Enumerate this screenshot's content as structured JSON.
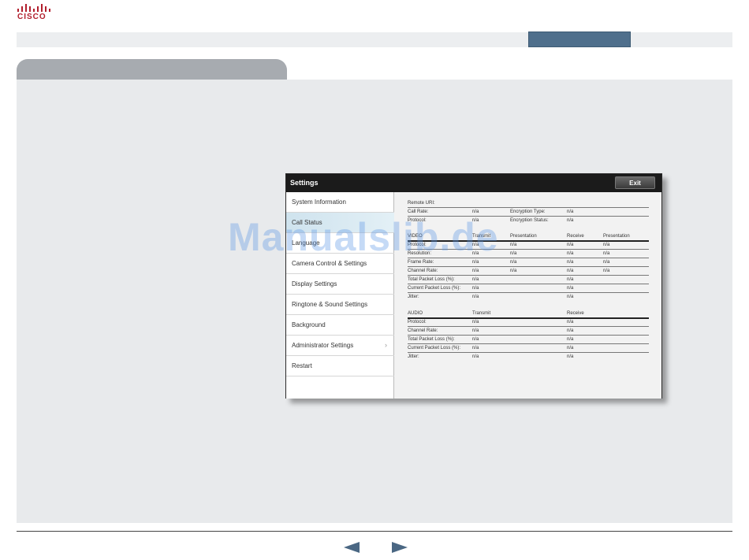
{
  "brand": {
    "logo_text": "CISCO",
    "color": "#b21f2d"
  },
  "nav": {
    "active_color": "#4f6f8c"
  },
  "window": {
    "title": "Settings",
    "exit_label": "Exit",
    "menu": [
      {
        "label": "System Information"
      },
      {
        "label": "Call Status"
      },
      {
        "label": "Language"
      },
      {
        "label": "Camera Control & Settings"
      },
      {
        "label": "Display Settings"
      },
      {
        "label": "Ringtone & Sound Settings"
      },
      {
        "label": "Background"
      },
      {
        "label": "Administrator Settings",
        "chevron": "chevron-right-icon"
      },
      {
        "label": "Restart"
      }
    ],
    "detail": {
      "remote_uri_label": "Remote URI:",
      "call_rate_label": "Call Rate:",
      "call_rate_value": "n/a",
      "encryption_type_label": "Encryption Type:",
      "encryption_type_value": "n/a",
      "protocol_label": "Protocol:",
      "protocol_value": "n/a",
      "encryption_status_label": "Encryption Status:",
      "encryption_status_value": "n/a",
      "video": {
        "headers": [
          "VIDEO",
          "Transmit",
          "Presentation",
          "Receive",
          "Presentation"
        ],
        "rows": [
          {
            "label": "Protocol:",
            "values": [
              "n/a",
              "n/a",
              "n/a",
              "n/a"
            ]
          },
          {
            "label": "Resolution:",
            "values": [
              "n/a",
              "n/a",
              "n/a",
              "n/a"
            ]
          },
          {
            "label": "Frame Rate:",
            "values": [
              "n/a",
              "n/a",
              "n/a",
              "n/a"
            ]
          },
          {
            "label": "Channel Rate:",
            "values": [
              "n/a",
              "n/a",
              "n/a",
              "n/a"
            ]
          },
          {
            "label": "Total Packet Loss (%):",
            "values": [
              "n/a",
              "",
              "n/a",
              ""
            ]
          },
          {
            "label": "Current Packet Loss (%):",
            "values": [
              "n/a",
              "",
              "n/a",
              ""
            ]
          },
          {
            "label": "Jitter:",
            "values": [
              "n/a",
              "",
              "n/a",
              ""
            ]
          }
        ]
      },
      "audio": {
        "headers": [
          "AUDIO",
          "Transmit",
          "Receive"
        ],
        "rows": [
          {
            "label": "Protocol:",
            "values": [
              "n/a",
              "n/a"
            ]
          },
          {
            "label": "Channel Rate:",
            "values": [
              "n/a",
              "n/a"
            ]
          },
          {
            "label": "Total Packet Loss (%):",
            "values": [
              "n/a",
              "n/a"
            ]
          },
          {
            "label": "Current Packet Loss (%):",
            "values": [
              "n/a",
              "n/a"
            ]
          },
          {
            "label": "Jitter:",
            "values": [
              "n/a",
              "n/a"
            ]
          }
        ]
      }
    }
  },
  "watermark": "Manualslib.de",
  "footer": {
    "prev_icon": "arrow-left-icon",
    "next_icon": "arrow-right-icon"
  }
}
